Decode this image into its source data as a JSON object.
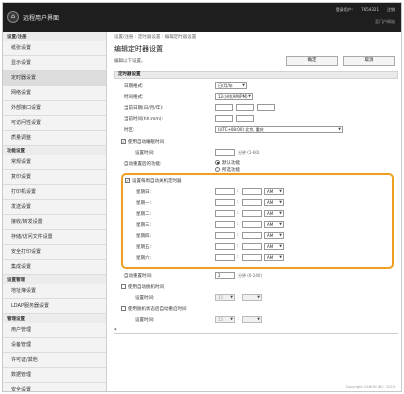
{
  "header": {
    "app_title": "远程用户界面",
    "top_links": [
      "登录用户:",
      "7654321",
      "注销"
    ],
    "sub_link": "至门户网站"
  },
  "sidebar": {
    "sections": [
      {
        "title": "设置/注册",
        "items": [
          "纸张设置",
          "显示设置",
          "定时器设置",
          "网络设置",
          "外部接口设置",
          "可访问性设置",
          "质量调整"
        ]
      },
      {
        "title": "功能设置",
        "items": [
          "常规设置",
          "复印设置",
          "打印机设置",
          "发送设置",
          "接收/转发设置",
          "存储/访问文件设置",
          "安全打印设置",
          "集成设置"
        ]
      },
      {
        "title": "设置管理",
        "items": [
          "地址簿设置",
          "LDAP服务器设置"
        ]
      },
      {
        "title": "管理设置",
        "items": [
          "用户管理",
          "设备管理",
          "许可证/其他",
          "数据管理",
          "安全设置"
        ]
      }
    ],
    "active_item": "定时器设置"
  },
  "main": {
    "breadcrumb": "设置/注册 : 定时器设置 : 编辑定时器设置",
    "title": "编辑定时器设置",
    "description": "编辑以下设置。",
    "ok_label": "确定",
    "cancel_label": "取消",
    "section_label": "定时器设置",
    "date_format_label": "日期格式:",
    "date_format_value": "日/月/年",
    "time_format_label": "时间格式:",
    "time_format_value": "12小时(AM/PM)",
    "current_date_label": "当前日期(日/月/年):",
    "current_time_label": "当前时间(hh:mm):",
    "timezone_label": "时区:",
    "timezone_value": "(UTC+08:00) 北京, 重庆",
    "auto_sleep_label": "使用自动睡眠时间",
    "auto_sleep_time_label": "设置时间:",
    "auto_sleep_unit": "分钟 (1-60)",
    "auto_reset_label": "自动重置后的功能:",
    "auto_reset_opt1": "默认功能",
    "auto_reset_opt2": "所选功能",
    "weekly_label": "设置每周自动关机定时器",
    "days": [
      "星期日:",
      "星期一:",
      "星期二:",
      "星期三:",
      "星期四:",
      "星期五:",
      "星期六:"
    ],
    "ampm_value": "AM",
    "auto_reset_time_label": "自动重置时间:",
    "auto_reset_time_value": "2",
    "auto_reset_time_unit": "分钟 (0-240)",
    "auto_offline_label": "使用自动脱机时间",
    "auto_offline_time_label": "设置时间:",
    "auto_offline_time_value": "15",
    "restart_label": "使用脱机状态后自动重启时间",
    "restart_time_label": "设置时间:",
    "restart_time_value": "15",
    "footnote_mark": "*",
    "copyright": "Copyright CANON INC. 2024"
  }
}
